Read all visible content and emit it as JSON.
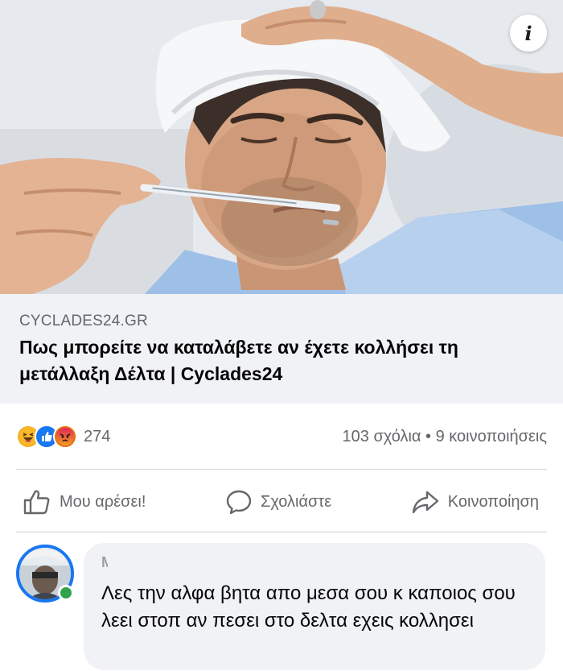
{
  "post": {
    "info_button": "i",
    "link": {
      "domain": "CYCLADES24.GR",
      "headline": "Πως μπορείτε να καταλάβετε αν έχετε κολλήσει τη μετάλλαξη Δέλτα | Cyclades24"
    },
    "reactions": {
      "icons": [
        "haha-icon",
        "like-icon",
        "angry-icon"
      ],
      "count": "274"
    },
    "stats": "103 σχόλια • 9 κοινοποιήσεις",
    "actions": {
      "like": "Μου αρέσει!",
      "comment": "Σχολιάστε",
      "share": "Κοινοποίηση"
    }
  },
  "comment": {
    "author": "Μ…   …ης Μουσταφης",
    "text": "Λες την αλφα βητα απο μεσα σου κ καποιος σου λεει στοπ αν πεσει στο δελτα εχεις κολλησει"
  },
  "colors": {
    "brand_blue": "#1877f2",
    "caption_bg": "#f0f2f5",
    "muted_text": "#65676b",
    "online_green": "#31a24c"
  }
}
